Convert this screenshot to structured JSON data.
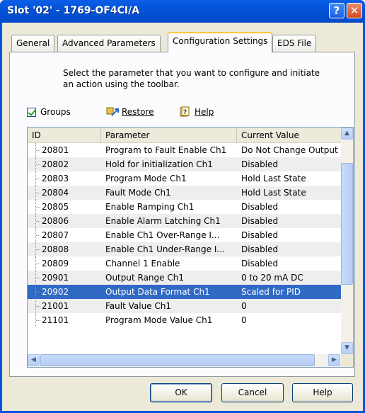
{
  "window": {
    "title": "Slot '02' - 1769-OF4CI/A",
    "help_glyph": "?",
    "close_glyph": "✕"
  },
  "tabs": [
    {
      "label": "General"
    },
    {
      "label": "Advanced Parameters"
    },
    {
      "label": "Configuration Settings",
      "active": true
    },
    {
      "label": "EDS File"
    }
  ],
  "instructions": "Select the parameter that you want to configure and initiate an action using the toolbar.",
  "toolbar": {
    "groups_label": "Groups",
    "groups_checked": true,
    "restore_label": "Restore",
    "help_label": "Help"
  },
  "table": {
    "columns": [
      "ID",
      "Parameter",
      "Current Value"
    ],
    "rows": [
      {
        "id": "20801",
        "param": "Program to Fault Enable Ch1",
        "value": "Do Not Change Output"
      },
      {
        "id": "20802",
        "param": "Hold for initialization Ch1",
        "value": "Disabled"
      },
      {
        "id": "20803",
        "param": "Program Mode Ch1",
        "value": "Hold Last State"
      },
      {
        "id": "20804",
        "param": "Fault Mode Ch1",
        "value": "Hold Last State"
      },
      {
        "id": "20805",
        "param": "Enable Ramping Ch1",
        "value": "Disabled"
      },
      {
        "id": "20806",
        "param": "Enable Alarm Latching Ch1",
        "value": "Disabled"
      },
      {
        "id": "20807",
        "param": "Enable Ch1 Over-Range I...",
        "value": "Disabled"
      },
      {
        "id": "20808",
        "param": "Enable Ch1 Under-Range I...",
        "value": "Disabled"
      },
      {
        "id": "20809",
        "param": "Channel 1 Enable",
        "value": "Disabled"
      },
      {
        "id": "20901",
        "param": "Output Range Ch1",
        "value": "0 to 20 mA DC"
      },
      {
        "id": "20902",
        "param": "Output Data Format Ch1",
        "value": "Scaled for PID",
        "selected": true
      },
      {
        "id": "21001",
        "param": "Fault Value Ch1",
        "value": "0"
      },
      {
        "id": "21101",
        "param": "Program Mode Value Ch1",
        "value": "0"
      }
    ]
  },
  "buttons": {
    "ok": "OK",
    "cancel": "Cancel",
    "help": "Help"
  },
  "colors": {
    "titlebar": "#0453d8",
    "selection": "#316ac5",
    "face": "#ece9d8"
  }
}
